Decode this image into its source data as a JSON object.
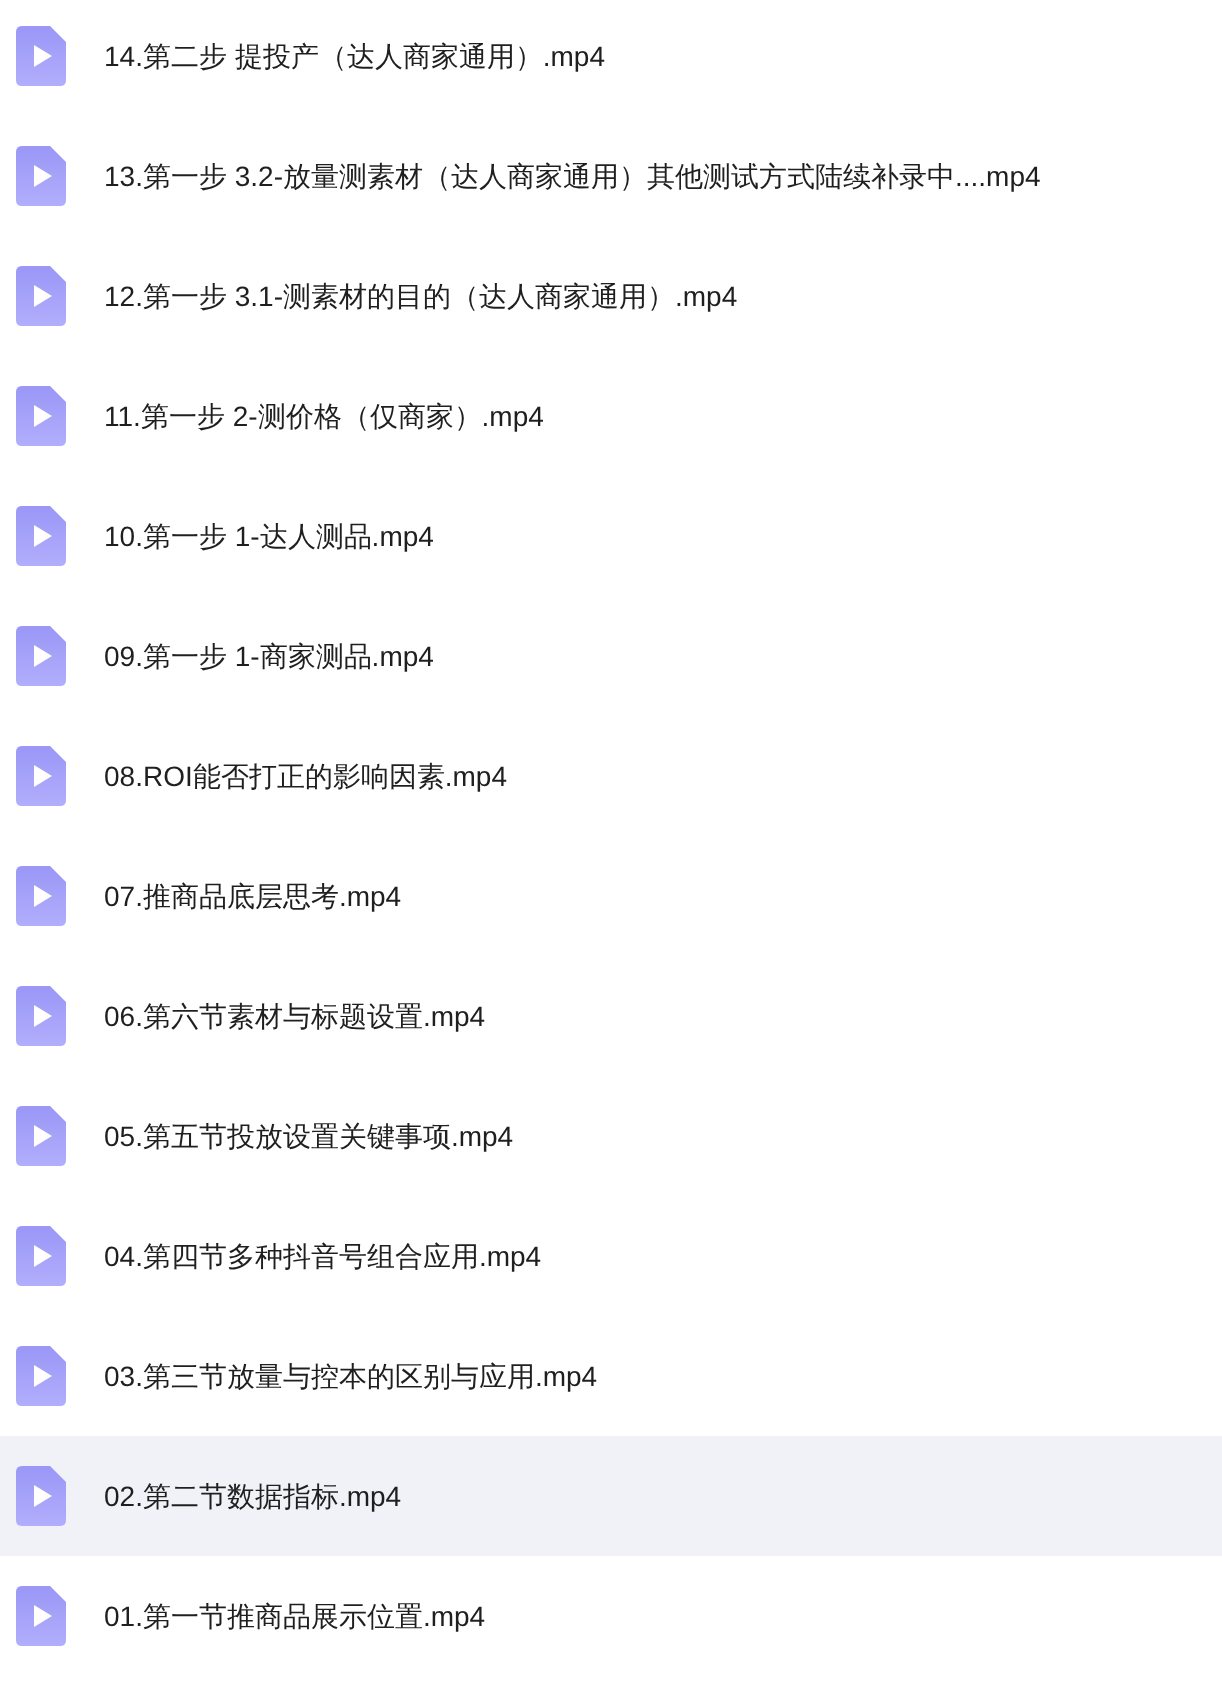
{
  "files": [
    {
      "name": "14.第二步 提投产（达人商家通用）.mp4",
      "selected": false
    },
    {
      "name": "13.第一步 3.2-放量测素材（达人商家通用）其他测试方式陆续补录中....mp4",
      "selected": false
    },
    {
      "name": "12.第一步 3.1-测素材的目的（达人商家通用）.mp4",
      "selected": false
    },
    {
      "name": "11.第一步 2-测价格（仅商家）.mp4",
      "selected": false
    },
    {
      "name": "10.第一步 1-达人测品.mp4",
      "selected": false
    },
    {
      "name": "09.第一步 1-商家测品.mp4",
      "selected": false
    },
    {
      "name": "08.ROI能否打正的影响因素.mp4",
      "selected": false
    },
    {
      "name": "07.推商品底层思考.mp4",
      "selected": false
    },
    {
      "name": "06.第六节素材与标题设置.mp4",
      "selected": false
    },
    {
      "name": "05.第五节投放设置关键事项.mp4",
      "selected": false
    },
    {
      "name": "04.第四节多种抖音号组合应用.mp4",
      "selected": false
    },
    {
      "name": "03.第三节放量与控本的区别与应用.mp4",
      "selected": false
    },
    {
      "name": "02.第二节数据指标.mp4",
      "selected": true
    },
    {
      "name": "01.第一节推商品展示位置.mp4",
      "selected": false
    }
  ]
}
